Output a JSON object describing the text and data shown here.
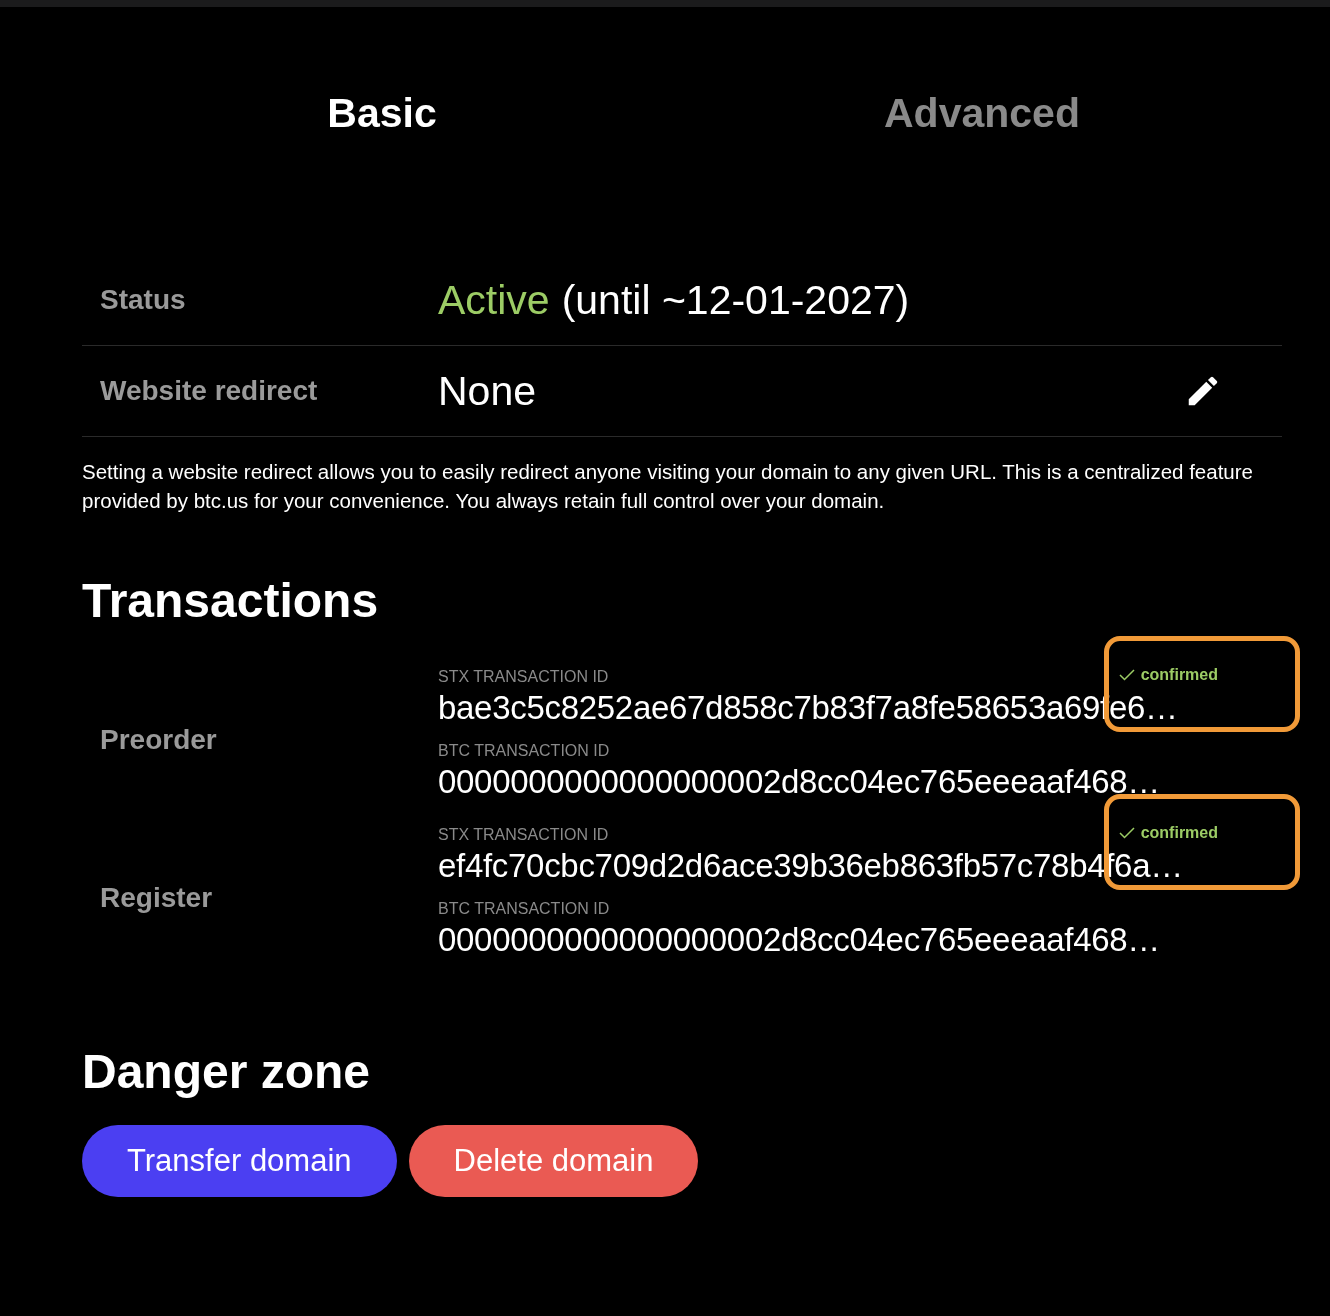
{
  "tabs": [
    {
      "label": "Basic",
      "selected": true
    },
    {
      "label": "Advanced",
      "selected": false
    }
  ],
  "details": [
    {
      "kind": "status",
      "label": "Status",
      "value": "Active",
      "note": "(until ~12-01-2027)"
    },
    {
      "kind": "editable",
      "label": "Website redirect",
      "value": "None"
    }
  ],
  "redirect_note": "Setting a website redirect allows you to easily redirect anyone visiting your domain to any given URL. This is a centralized feature provided by btc.us for your convenience. You always retain full control over your domain.",
  "transactions": {
    "title": "Transactions",
    "groups": [
      {
        "label": "Preorder",
        "entries": [
          {
            "caption": "STX TRANSACTION ID",
            "id": "bae3c5c8252ae67d858c7b83f7a8fe58653a69fe6…",
            "status": "confirmed",
            "highlighted": true
          },
          {
            "caption": "BTC TRANSACTION ID",
            "id": "0000000000000000002d8cc04ec765eeeaaf468…",
            "highlighted": false
          }
        ]
      },
      {
        "label": "Register",
        "entries": [
          {
            "caption": "STX TRANSACTION ID",
            "id": "ef4fc70cbc709d2d6ace39b36eb863fb57c78b4f6a…",
            "status": "confirmed",
            "highlighted": true
          },
          {
            "caption": "BTC TRANSACTION ID",
            "id": "0000000000000000002d8cc04ec765eeeaaf468…",
            "highlighted": false
          }
        ]
      }
    ]
  },
  "danger_zone": {
    "title": "Danger zone",
    "buttons": [
      {
        "label": "Transfer domain",
        "kind": "primary"
      },
      {
        "label": "Delete domain",
        "kind": "danger"
      }
    ]
  }
}
